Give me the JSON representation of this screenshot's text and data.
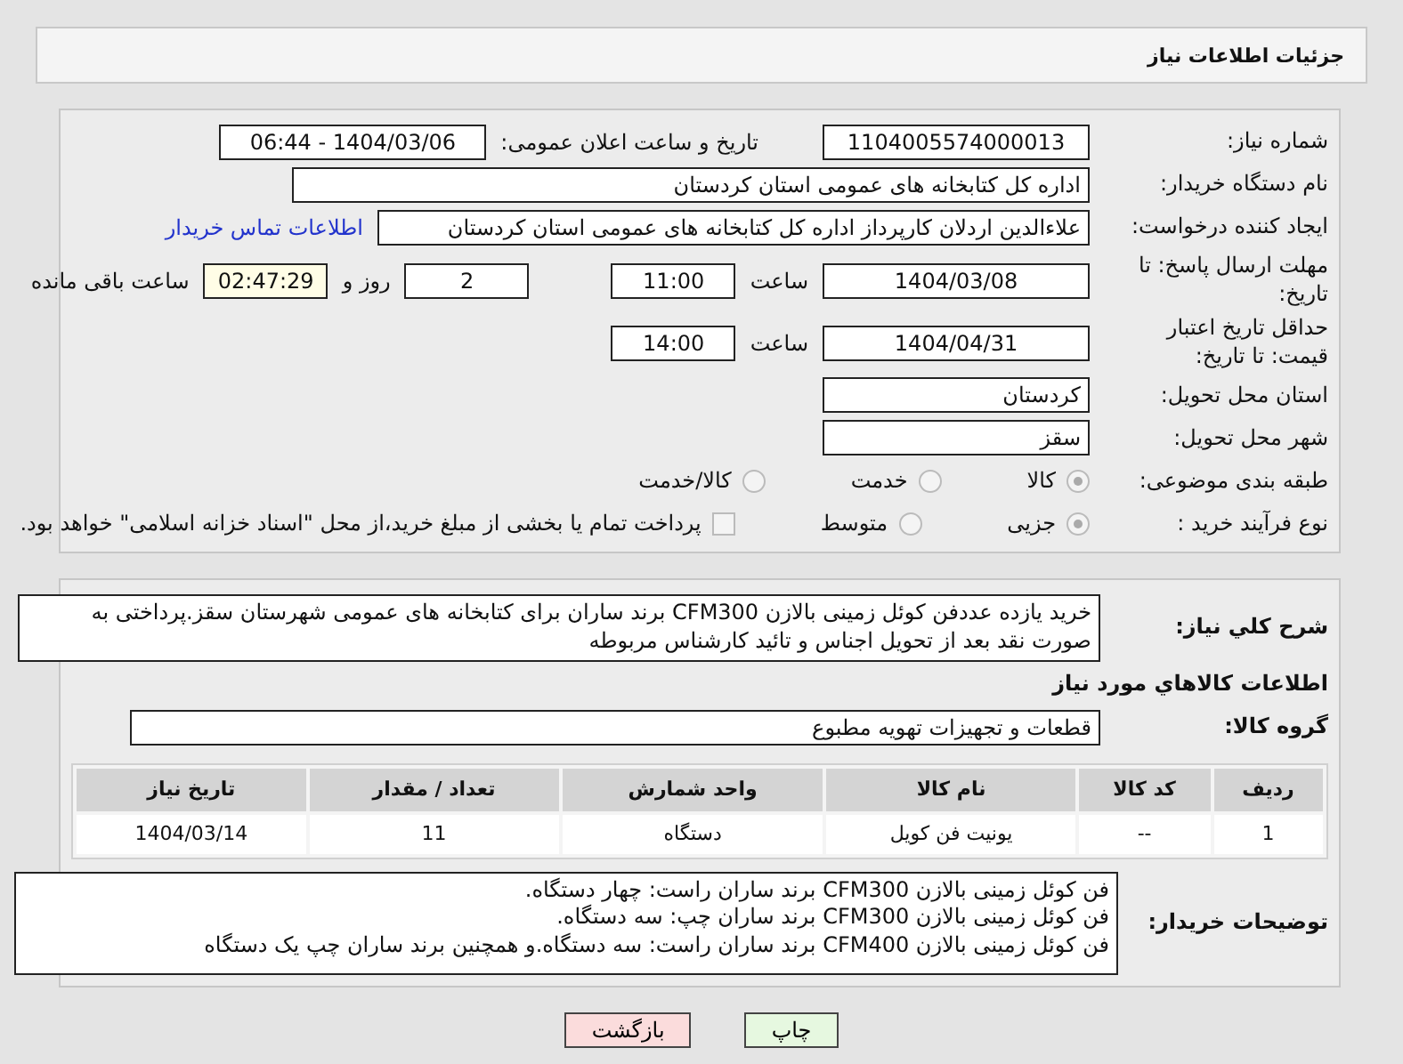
{
  "header": {
    "title": "جزئیات اطلاعات نیاز"
  },
  "need_number": {
    "label": "شماره نیاز:",
    "value": "1104005574000013"
  },
  "announce": {
    "label": "تاریخ و ساعت اعلان عمومی:",
    "value": "1404/03/06 - 06:44"
  },
  "buyer_org": {
    "label": "نام دستگاه خریدار:",
    "value": "اداره کل کتابخانه های عمومی استان کردستان"
  },
  "requester": {
    "label": "ایجاد کننده درخواست:",
    "value": "علاءالدین اردلان کارپرداز اداره کل کتابخانه های عمومی استان کردستان",
    "link": "اطلاعات تماس خریدار"
  },
  "deadline": {
    "label": "مهلت ارسال پاسخ: تا تاریخ:",
    "date": "1404/03/08",
    "time_label": "ساعت",
    "time": "11:00",
    "days": "2",
    "days_label": "روز و",
    "remaining": "02:47:29",
    "remaining_label": "ساعت باقی مانده"
  },
  "validity": {
    "label": "حداقل تاریخ اعتبار قیمت: تا تاریخ:",
    "date": "1404/04/31",
    "time_label": "ساعت",
    "time": "14:00"
  },
  "province": {
    "label": "استان محل تحویل:",
    "value": "کردستان"
  },
  "city": {
    "label": "شهر محل تحویل:",
    "value": "سقز"
  },
  "category": {
    "label": "طبقه بندی موضوعی:",
    "options": [
      {
        "label": "کالا",
        "selected": true
      },
      {
        "label": "خدمت",
        "selected": false
      },
      {
        "label": "کالا/خدمت",
        "selected": false
      }
    ]
  },
  "process": {
    "label": "نوع فرآیند خرید :",
    "options": [
      {
        "label": "جزیی",
        "selected": true
      },
      {
        "label": "متوسط",
        "selected": false
      }
    ],
    "payment": {
      "label": "پرداخت تمام یا بخشی از مبلغ خرید،از محل \"اسناد خزانه اسلامی\" خواهد بود.",
      "checked": false
    }
  },
  "description": {
    "label": "شرح کلي نياز:",
    "text": "خرید یازده عددفن کوئل زمینی بالازن CFM300 برند ساران برای کتابخانه های عمومی شهرستان سقز.پرداختی به صورت نقد بعد از تحویل اجناس و تائید کارشناس مربوطه"
  },
  "items_title": "اطلاعات کالاهاي مورد نياز",
  "goods_group": {
    "label": "گروه کالا:",
    "value": "قطعات و تجهیزات تهویه مطبوع"
  },
  "table": {
    "columns": [
      "ردیف",
      "کد کالا",
      "نام کالا",
      "واحد شمارش",
      "تعداد / مقدار",
      "تاریخ نیاز"
    ],
    "rows": [
      [
        "1",
        "--",
        "یونیت فن کویل",
        "دستگاه",
        "11",
        "1404/03/14"
      ]
    ]
  },
  "buyer_notes": {
    "label": "توضیحات خریدار:",
    "lines": [
      "فن کوئل زمینی بالازن CFM300 برند ساران راست: چهار دستگاه.",
      "فن کوئل زمینی بالازن CFM300 برند ساران چپ: سه دستگاه.",
      "فن کوئل زمینی بالازن CFM400 برند ساران راست: سه دستگاه.و همچنین برند ساران چپ یک دستگاه"
    ]
  },
  "buttons": [
    {
      "label": "چاپ",
      "kind": "print"
    },
    {
      "label": "بازگشت",
      "kind": "back"
    }
  ]
}
